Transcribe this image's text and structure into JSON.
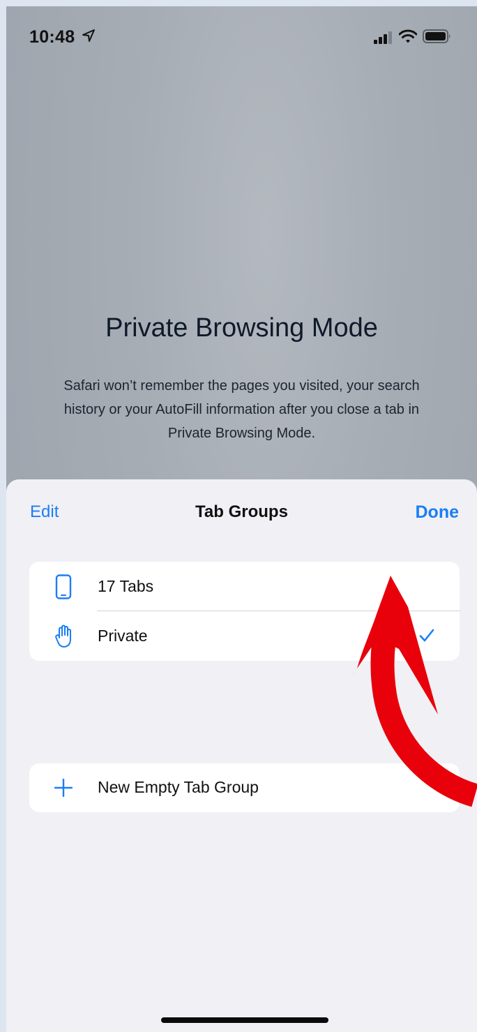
{
  "status_bar": {
    "time": "10:48"
  },
  "private_browsing": {
    "title": "Private Browsing Mode",
    "description": "Safari won’t remember the pages you visited, your search history or your AutoFill information after you close a tab in Private Browsing Mode."
  },
  "sheet": {
    "edit_label": "Edit",
    "title": "Tab Groups",
    "done_label": "Done",
    "groups": [
      {
        "label": "17 Tabs",
        "icon": "phone-icon",
        "selected": false
      },
      {
        "label": "Private",
        "icon": "hand-icon",
        "selected": true
      }
    ],
    "new_group_label": "New Empty Tab Group"
  },
  "colors": {
    "accent": "#1a7ef5",
    "annotation": "#e8000b"
  }
}
